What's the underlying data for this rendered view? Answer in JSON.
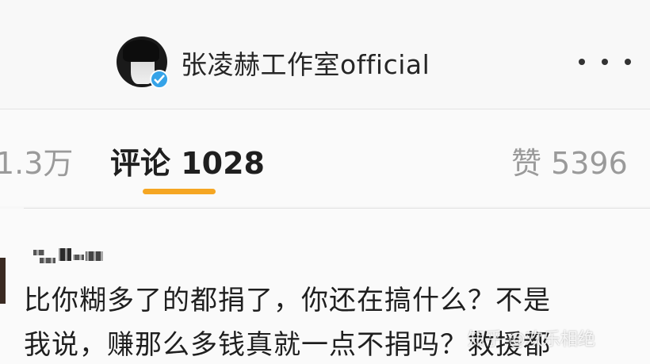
{
  "header": {
    "account_name": "张凌赫工作室official",
    "more_icon": "more-horizontal-icon",
    "verify_icon": "verified-badge-icon",
    "verify_color": "#35a3e8"
  },
  "tabs": {
    "reposts_label": "1.3万",
    "comments_label": "评论 1028",
    "likes_label": "赞 5396",
    "active_color": "#f5a623"
  },
  "comment": {
    "line1": "比你糊多了的都捐了，你还在搞什么？不是",
    "line2": "我说，赚那么多钱真就一点不捐吗？救援都"
  },
  "watermark": "知乎 @欢乐相绝"
}
